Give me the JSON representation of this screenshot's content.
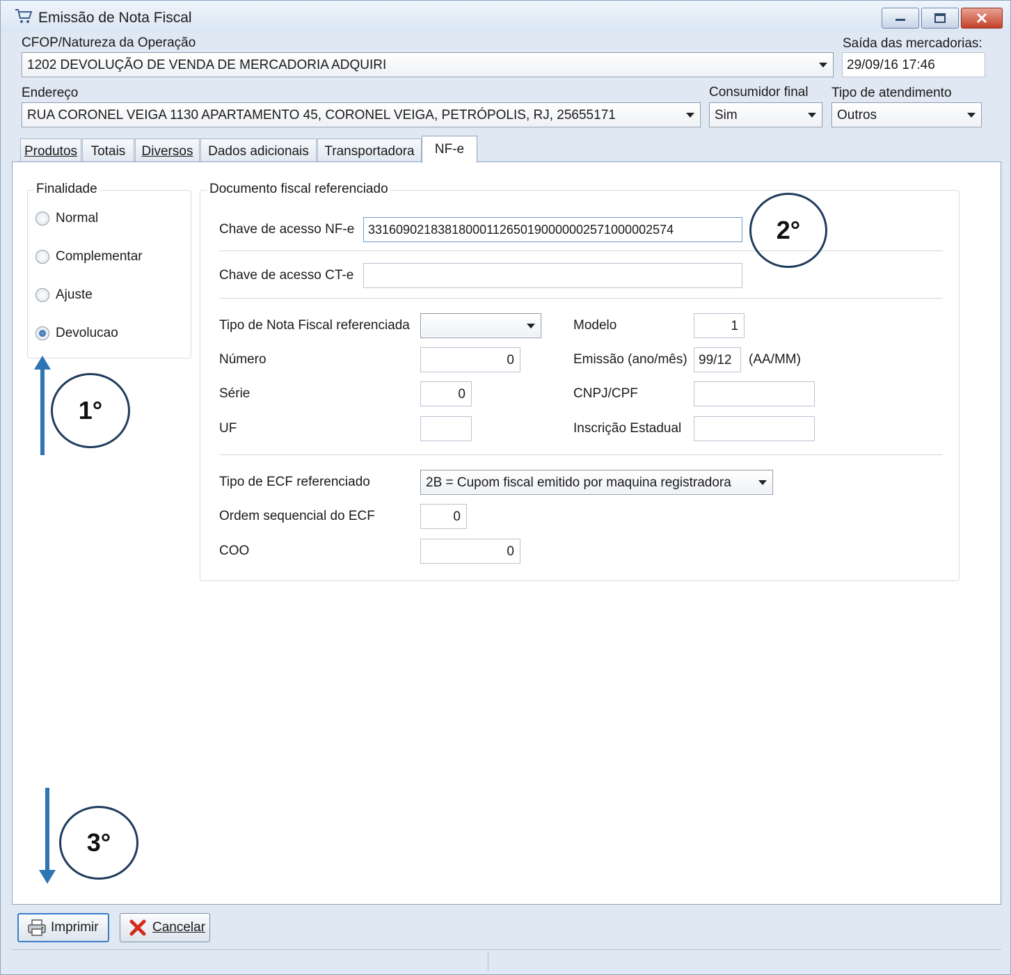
{
  "window": {
    "title": "Emissão de Nota Fiscal",
    "icon": "cart-icon",
    "controls": [
      "minimize-icon",
      "maximize-icon",
      "close-icon"
    ]
  },
  "header": {
    "cfop_label": "CFOP/Natureza da Operação",
    "cfop_value": "1202 DEVOLUÇÃO DE VENDA DE MERCADORIA ADQUIRI",
    "saida_label": "Saída das mercadorias:",
    "saida_value": "29/09/16 17:46",
    "endereco_label": "Endereço",
    "endereco_value": "RUA CORONEL VEIGA 1130 APARTAMENTO 45, CORONEL VEIGA, PETRÓPOLIS, RJ, 25655171",
    "consumidor_label": "Consumidor final",
    "consumidor_value": "Sim",
    "atendimento_label": "Tipo de atendimento",
    "atendimento_value": "Outros"
  },
  "tabs": [
    {
      "label": "Produtos"
    },
    {
      "label": "Totais"
    },
    {
      "label": "Diversos"
    },
    {
      "label": "Dados adicionais"
    },
    {
      "label": "Transportadora"
    },
    {
      "label": "NF-e",
      "active": true
    }
  ],
  "finalidade": {
    "title": "Finalidade",
    "options": [
      "Normal",
      "Complementar",
      "Ajuste",
      "Devolucao"
    ],
    "selected": "Devolucao"
  },
  "documento": {
    "title": "Documento fiscal referenciado",
    "chave_nfe_label": "Chave de acesso NF-e",
    "chave_nfe_value": "33160902183818000112650190000002571000002574",
    "chave_cte_label": "Chave de acesso CT-e",
    "chave_cte_value": "",
    "tipo_nf_label": "Tipo de Nota Fiscal referenciada",
    "tipo_nf_value": "",
    "numero_label": "Número",
    "numero_value": "0",
    "serie_label": "Série",
    "serie_value": "0",
    "uf_label": "UF",
    "uf_value": "",
    "modelo_label": "Modelo",
    "modelo_value": "1",
    "emissao_label": "Emissão (ano/mês)",
    "emissao_value": "99/12",
    "emissao_hint": "(AA/MM)",
    "cnpj_label": "CNPJ/CPF",
    "cnpj_value": "",
    "ie_label": "Inscrição Estadual",
    "ie_value": "",
    "ecf_tipo_label": "Tipo de ECF referenciado",
    "ecf_tipo_value": "2B = Cupom fiscal emitido por maquina registradora",
    "ecf_ordem_label": "Ordem sequencial do ECF",
    "ecf_ordem_value": "0",
    "coo_label": "COO",
    "coo_value": "0"
  },
  "annotations": {
    "step1": "1°",
    "step2": "2°",
    "step3": "3°",
    "arrow_color": "#2e75b6"
  },
  "buttons": {
    "print_label": "Imprimir",
    "print_icon": "printer-icon",
    "cancel_label": "Cancelar",
    "cancel_icon": "x-icon",
    "cancel_icon_color": "#d42a1a"
  }
}
